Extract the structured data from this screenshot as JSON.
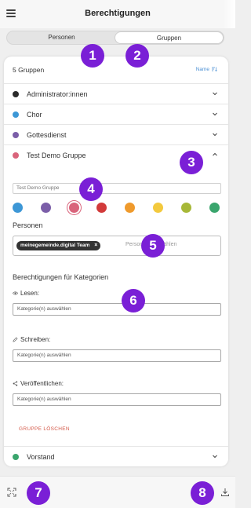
{
  "header": {
    "title": "Berechtigungen"
  },
  "tabs": [
    {
      "label": "Personen",
      "active": false
    },
    {
      "label": "Gruppen",
      "active": true
    }
  ],
  "list": {
    "count_label": "5 Gruppen",
    "sort_label": "Name",
    "groups": [
      {
        "name": "Administrator:innen",
        "color": "#2b2b2b",
        "expanded": false
      },
      {
        "name": "Chor",
        "color": "#3d97d6",
        "expanded": false
      },
      {
        "name": "Gottesdienst",
        "color": "#7b5ea8",
        "expanded": false
      },
      {
        "name": "Test Demo Gruppe",
        "color": "#d9647b",
        "expanded": true
      },
      {
        "name": "Vorstand",
        "color": "#3aa56d",
        "expanded": false
      }
    ]
  },
  "editor": {
    "group_name_placeholder": "Test Demo Gruppe",
    "colors": [
      "#3d97d6",
      "#7b5ea8",
      "#d9647b",
      "#d23a3a",
      "#ef9a2c",
      "#f3c93d",
      "#a7b838",
      "#3aa56d"
    ],
    "selected_color": "#d9647b",
    "persons_title": "Personen",
    "persons_chip": "meinegemeinde.digital Team",
    "persons_chip_remove": "×",
    "persons_placeholder": "Personen auswählen",
    "permissions_title": "Berechtigungen für Kategorien",
    "read_label": "Lesen:",
    "read_placeholder": "Kategorie(n) auswählen",
    "write_label": "Schreiben:",
    "write_placeholder": "Kategorie(n) auswählen",
    "publish_label": "Veröffentlichen:",
    "publish_placeholder": "Kategorie(n) auswählen",
    "delete_label": "GRUPPE LÖSCHEN"
  },
  "markers": [
    "1",
    "2",
    "3",
    "4",
    "5",
    "6",
    "7",
    "8"
  ],
  "icons": {
    "menu": "hamburger-icon",
    "sort": "sort-icon",
    "chevron": "chevron-icon",
    "read": "eye-icon",
    "write": "pencil-icon",
    "publish": "share-icon",
    "fullscreen": "fullscreen-icon",
    "download": "download-icon"
  }
}
